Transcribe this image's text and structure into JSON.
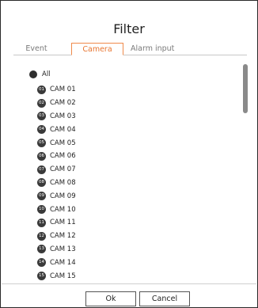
{
  "dialog": {
    "title": "Filter"
  },
  "tabs": [
    {
      "label": "Event",
      "active": false
    },
    {
      "label": "Camera",
      "active": true
    },
    {
      "label": "Alarm input",
      "active": false
    }
  ],
  "list": {
    "all_label": "All",
    "cameras": [
      {
        "num": "01",
        "label": "CAM 01"
      },
      {
        "num": "02",
        "label": "CAM 02"
      },
      {
        "num": "03",
        "label": "CAM 03"
      },
      {
        "num": "04",
        "label": "CAM 04"
      },
      {
        "num": "05",
        "label": "CAM 05"
      },
      {
        "num": "06",
        "label": "CAM 06"
      },
      {
        "num": "07",
        "label": "CAM 07"
      },
      {
        "num": "08",
        "label": "CAM 08"
      },
      {
        "num": "09",
        "label": "CAM 09"
      },
      {
        "num": "10",
        "label": "CAM 10"
      },
      {
        "num": "11",
        "label": "CAM 11"
      },
      {
        "num": "12",
        "label": "CAM 12"
      },
      {
        "num": "13",
        "label": "CAM 13"
      },
      {
        "num": "14",
        "label": "CAM 14"
      },
      {
        "num": "15",
        "label": "CAM 15"
      }
    ]
  },
  "buttons": {
    "ok": "Ok",
    "cancel": "Cancel"
  },
  "colors": {
    "active_tab": "#e87530",
    "badge": "#3a3a3a"
  }
}
